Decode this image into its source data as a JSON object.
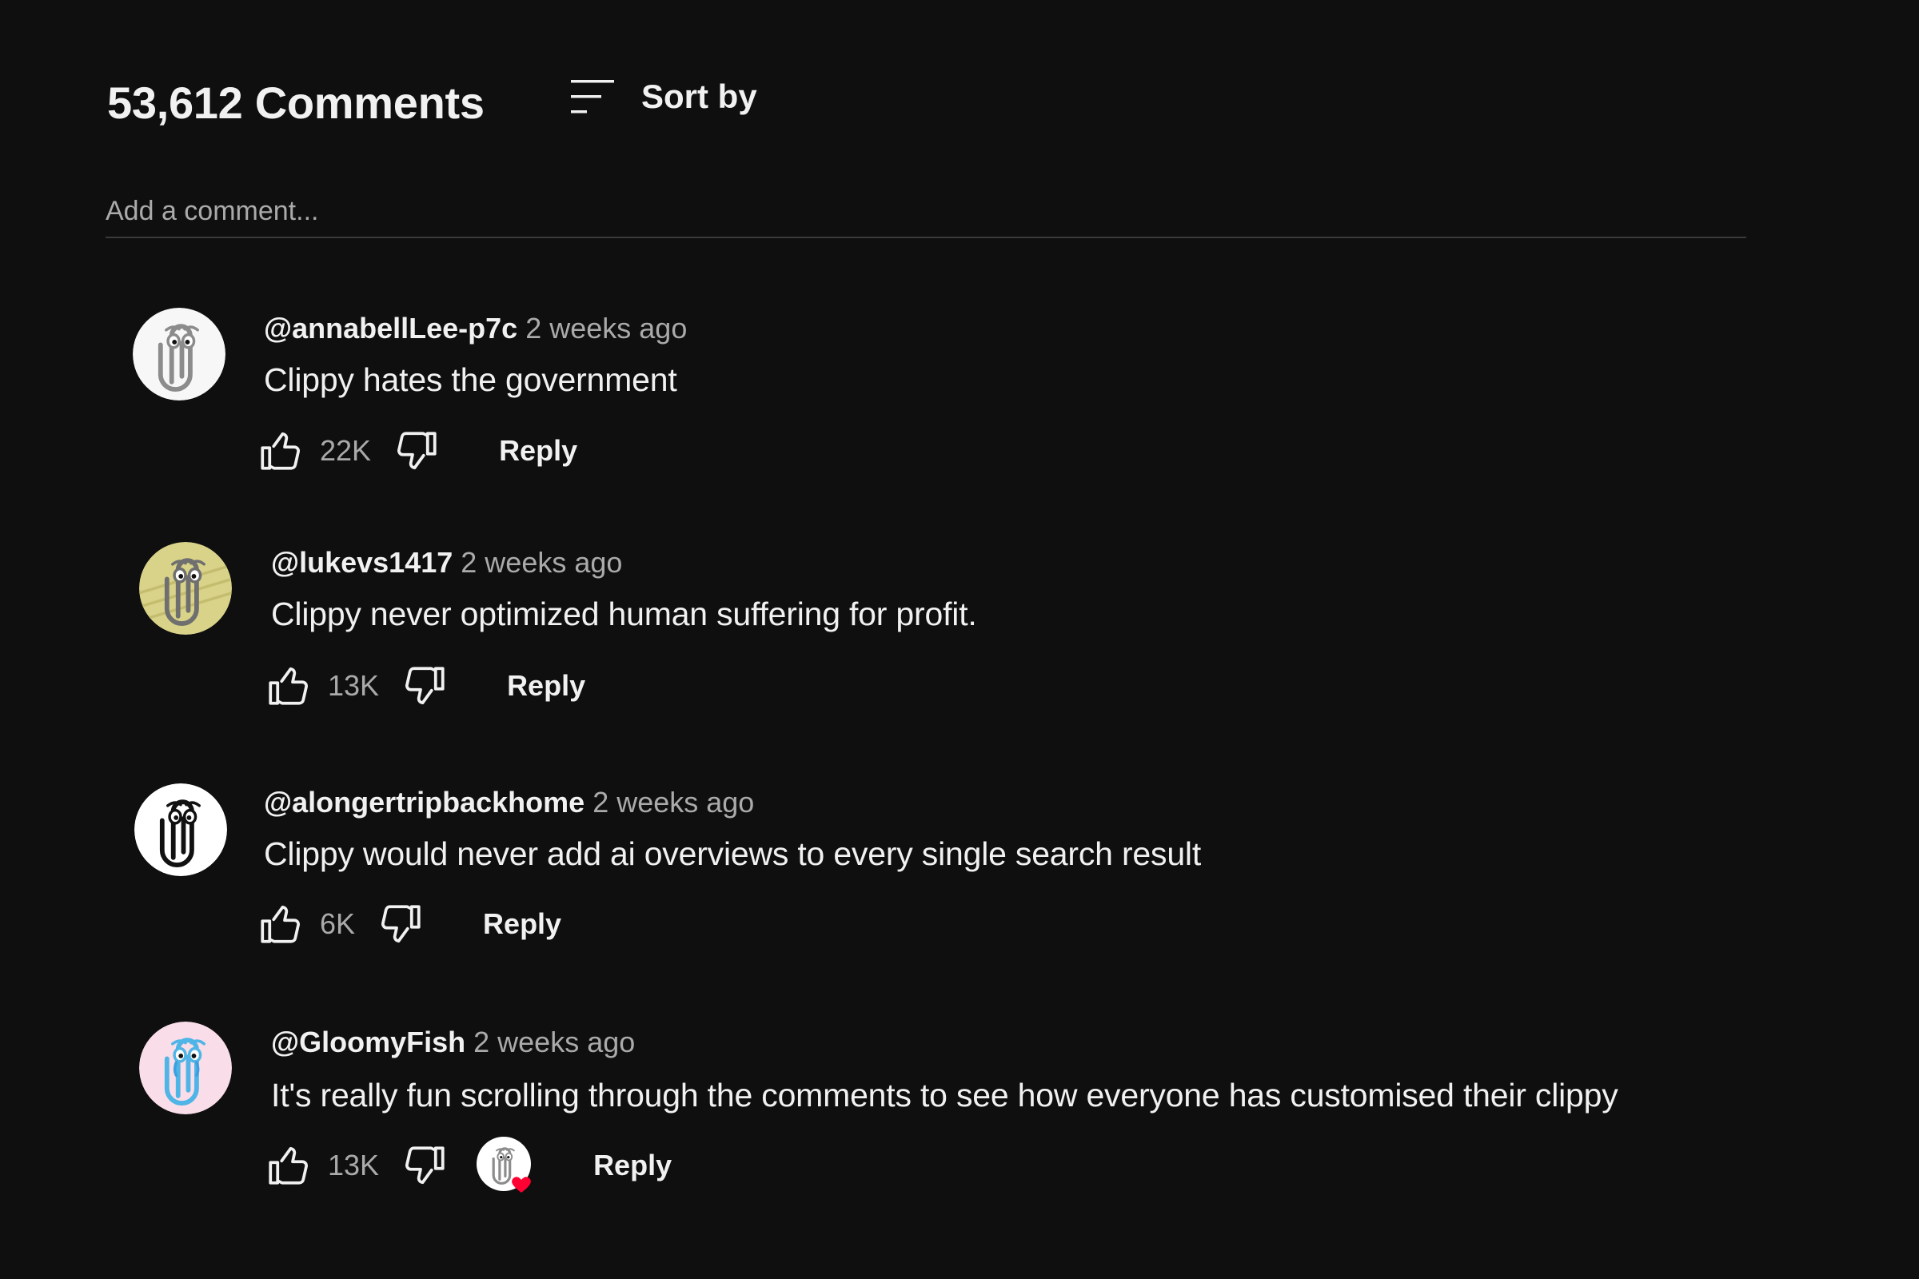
{
  "header": {
    "comment_count": "53,612 Comments",
    "sort_label": "Sort by"
  },
  "add_comment": {
    "placeholder": "Add a comment..."
  },
  "comments": [
    {
      "author": "@annabellLee-p7c",
      "time": "2 weeks ago",
      "text": "Clippy hates the government",
      "likes": "22K",
      "reply_label": "Reply",
      "avatar": "clippy-avatar-white"
    },
    {
      "author": "@lukevs1417",
      "time": "2 weeks ago",
      "text": "Clippy never optimized human suffering for profit.",
      "likes": "13K",
      "reply_label": "Reply",
      "avatar": "clippy-avatar-yellow-paper"
    },
    {
      "author": "@alongertripbackhome",
      "time": "2 weeks ago",
      "text": "Clippy would never add ai overviews to every single search result",
      "likes": "6K",
      "reply_label": "Reply",
      "avatar": "clippy-avatar-black-outline"
    },
    {
      "author": "@GloomyFish",
      "time": "2 weeks ago",
      "text": "It's really fun scrolling through the comments to see how everyone has customised their clippy",
      "likes": "13K",
      "reply_label": "Reply",
      "avatar": "clippy-avatar-pink-crying",
      "creator_heart": true
    }
  ],
  "icons": {
    "sort": "sort-icon",
    "like": "thumbs-up-icon",
    "dislike": "thumbs-down-icon",
    "creator_heart": "creator-heart-icon"
  },
  "colors": {
    "background": "#0f0f0f",
    "text_primary": "#f1f1f1",
    "text_secondary": "#aaaaaa",
    "divider": "#3a3a3a",
    "heart": "#ff0033"
  }
}
